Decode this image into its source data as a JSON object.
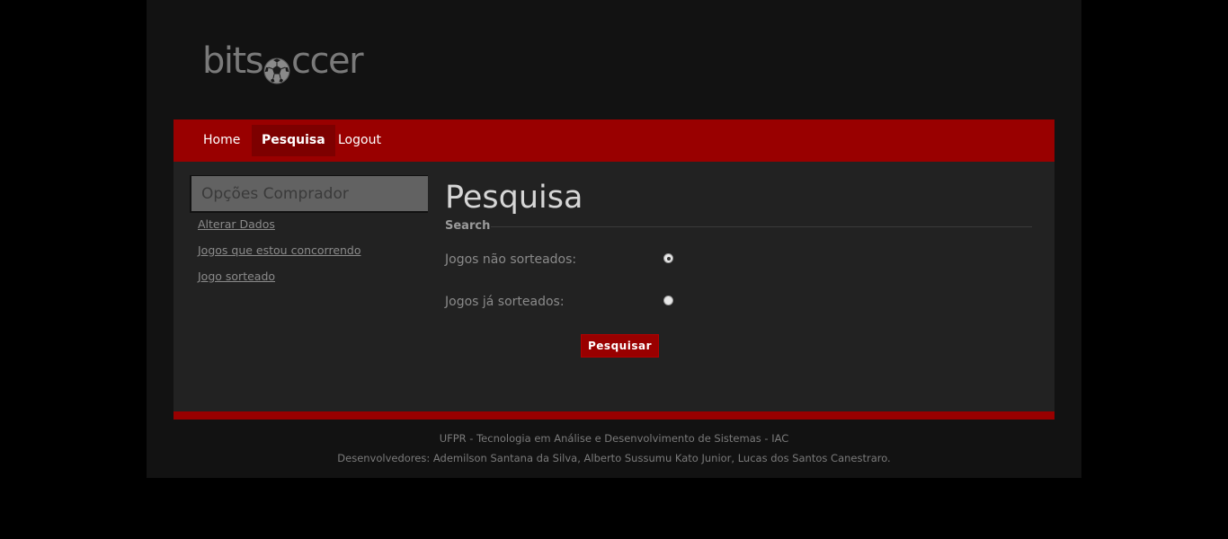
{
  "logo": {
    "text_before": "bits",
    "text_after": "ccer",
    "ball_icon": "soccer-ball-icon"
  },
  "nav": {
    "items": [
      {
        "label": "Home",
        "active": false
      },
      {
        "label": "Pesquisa",
        "active": true
      },
      {
        "label": "Logout",
        "active": false
      }
    ]
  },
  "sidebar": {
    "title": "Opções Comprador",
    "links": [
      "Alterar Dados",
      "Jogos que estou concorrendo",
      "Jogo sorteado"
    ]
  },
  "main": {
    "title": "Pesquisa",
    "legend": "Search",
    "options": [
      {
        "label": "Jogos não sorteados:",
        "checked": true
      },
      {
        "label": "Jogos já sorteados:",
        "checked": false
      }
    ],
    "submit_label": "Pesquisar"
  },
  "footer": {
    "line1": "UFPR - Tecnologia em Análise e Desenvolvimento de Sistemas - IAC",
    "line2": "Desenvolvedores: Ademilson Santana da Silva, Alberto Sussumu Kato Junior, Lucas dos Santos Canestraro."
  },
  "colors": {
    "brand_red": "#990000",
    "active_nav": "#7d0000",
    "background": "#121212",
    "content_bg": "#222222"
  }
}
